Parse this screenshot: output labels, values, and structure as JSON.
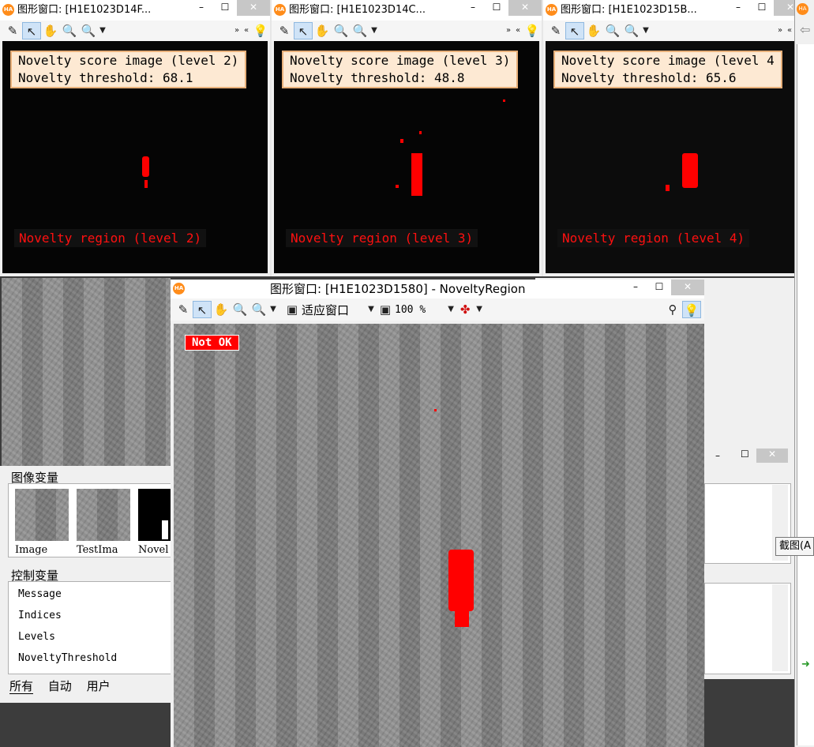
{
  "windows": [
    {
      "title": "图形窗口: [H1E1023D14F...",
      "line1": "Novelty score image (level 2)",
      "line2": "Novelty threshold: 68.1",
      "region": "Novelty region (level 2)"
    },
    {
      "title": "图形窗口: [H1E1023D14C...",
      "line1": "Novelty score image (level 3)",
      "line2": "Novelty threshold: 48.8",
      "region": "Novelty region (level 3)"
    },
    {
      "title": "图形窗口: [H1E1023D15B...",
      "line1": "Novelty score image (level 4",
      "line2": "Novelty threshold: 65.6",
      "region": "Novelty region (level 4)"
    }
  ],
  "main_window": {
    "title": "图形窗口: [H1E1023D1580] - NoveltyRegion",
    "fit_label": "适应窗口",
    "zoom_label": "100 %",
    "badge": "Not OK"
  },
  "variables": {
    "image_section": "图像变量",
    "images": [
      "Image",
      "TestIma",
      "Novel"
    ],
    "control_section": "控制变量",
    "controls": [
      "Message",
      "Indices",
      "Levels",
      "NoveltyThreshold"
    ],
    "tabs": [
      "所有",
      "自动",
      "用户"
    ]
  },
  "tooltip": "截图(A",
  "icons": [
    "halcon-app-icon",
    "edit-icon",
    "pointer-icon",
    "hand-icon",
    "magnifier-icon",
    "zoom-icon",
    "lightbulb-icon",
    "fit-window-icon",
    "zoom-percent-icon",
    "color-icon",
    "person-icon",
    "minimize-icon",
    "maximize-icon",
    "close-icon"
  ],
  "colors": {
    "novelty_red": "#ff0000",
    "label_bg": "#fde9d3",
    "badge_red": "#ff0000"
  }
}
